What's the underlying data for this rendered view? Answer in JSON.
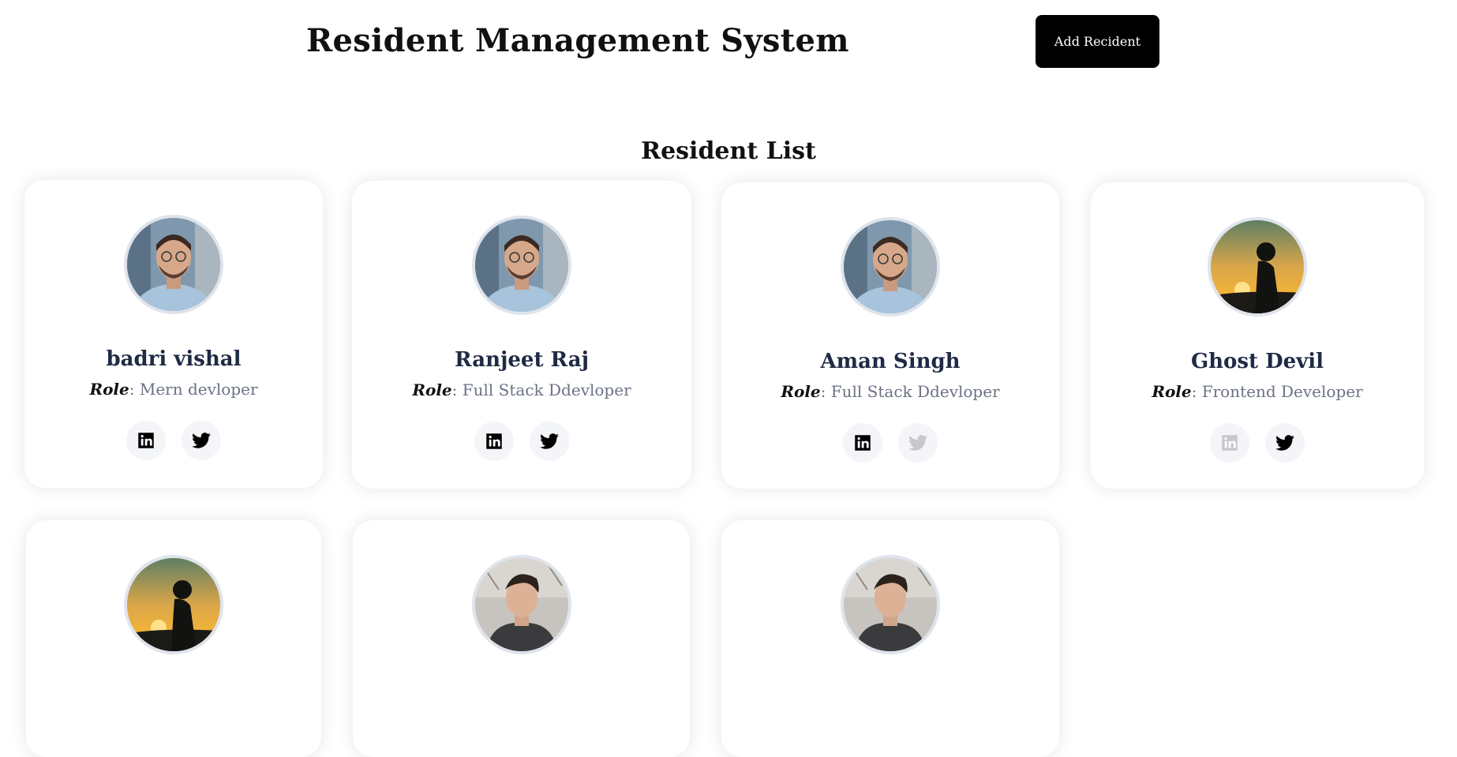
{
  "header": {
    "title": "Resident Management System",
    "add_button_label": "Add Recident"
  },
  "list": {
    "title": "Resident List",
    "role_prefix": "Role"
  },
  "residents": [
    {
      "name": "badri vishal",
      "role": "Mern devloper",
      "avatar": "man-glasses-photo",
      "linkedin_active": true,
      "twitter_active": true
    },
    {
      "name": "Ranjeet Raj",
      "role": "Full Stack Ddevloper",
      "avatar": "man-glasses-photo",
      "linkedin_active": true,
      "twitter_active": true
    },
    {
      "name": "Aman Singh",
      "role": "Full Stack Ddevloper",
      "avatar": "man-glasses-photo",
      "linkedin_active": true,
      "twitter_active": false
    },
    {
      "name": "Ghost Devil",
      "role": "Frontend Developer",
      "avatar": "sunset-silhouette-photo",
      "linkedin_active": false,
      "twitter_active": true
    },
    {
      "name": "",
      "role": "",
      "avatar": "sunset-silhouette-photo"
    },
    {
      "name": "",
      "role": "",
      "avatar": "man-jacket-photo"
    },
    {
      "name": "",
      "role": "",
      "avatar": "man-jacket-photo"
    }
  ],
  "icons": {
    "linkedin": "linkedin-icon",
    "twitter": "twitter-icon"
  },
  "colors": {
    "button_bg": "#000000",
    "name_color": "#1f2a44",
    "role_color": "#6b7285",
    "disabled_icon": "#c8c8cc"
  }
}
